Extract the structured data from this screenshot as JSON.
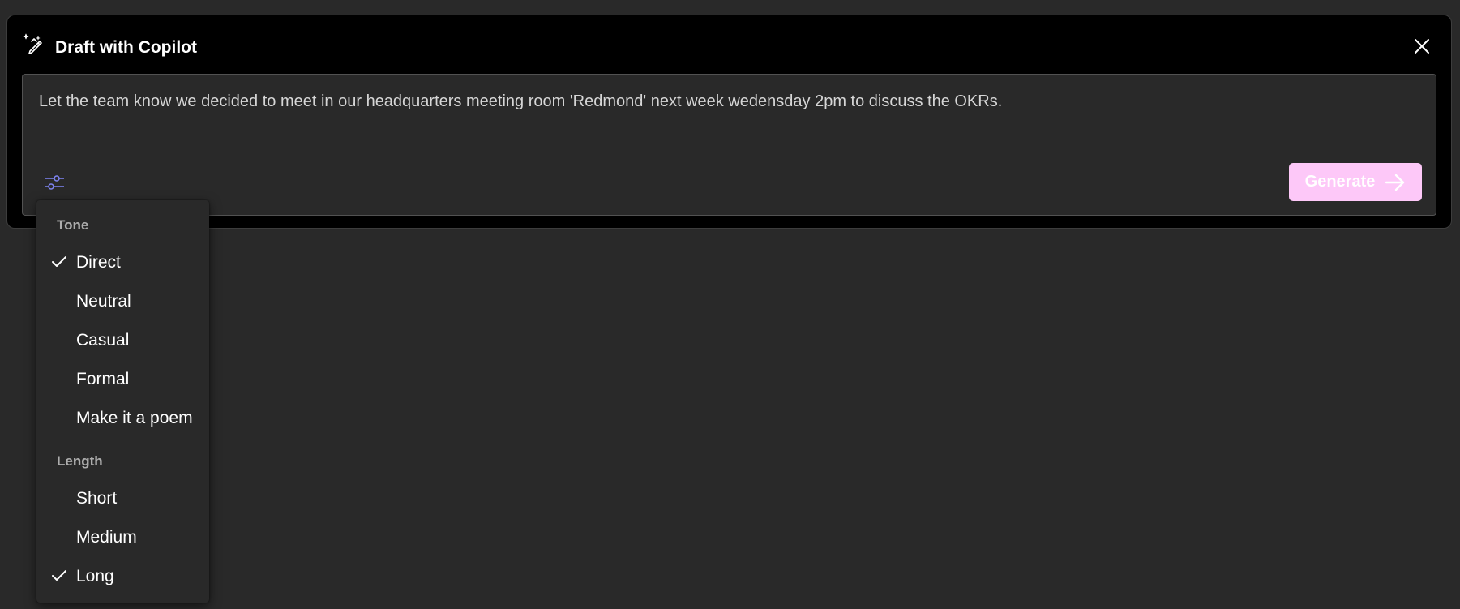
{
  "dialog": {
    "title": "Draft with Copilot",
    "prompt": "Let the team know we decided to meet in our headquarters meeting room 'Redmond' next week wedensday 2pm to discuss the OKRs.",
    "generate_label": "Generate"
  },
  "menu": {
    "tone_header": "Tone",
    "tone_items": [
      {
        "label": "Direct",
        "checked": true
      },
      {
        "label": "Neutral",
        "checked": false
      },
      {
        "label": "Casual",
        "checked": false
      },
      {
        "label": "Formal",
        "checked": false
      },
      {
        "label": "Make it a poem",
        "checked": false
      }
    ],
    "length_header": "Length",
    "length_items": [
      {
        "label": "Short",
        "checked": false
      },
      {
        "label": "Medium",
        "checked": false
      },
      {
        "label": "Long",
        "checked": true
      }
    ]
  },
  "colors": {
    "background": "#292929",
    "dialog_bg": "#000000",
    "generate_bg": "#fdc8f8",
    "accent": "#7f85f5"
  },
  "icons": {
    "copilot": "copilot-pen-sparkle-icon",
    "close": "close-icon",
    "settings": "sliders-icon",
    "generate": "arrow-right-icon",
    "check": "checkmark-icon"
  }
}
